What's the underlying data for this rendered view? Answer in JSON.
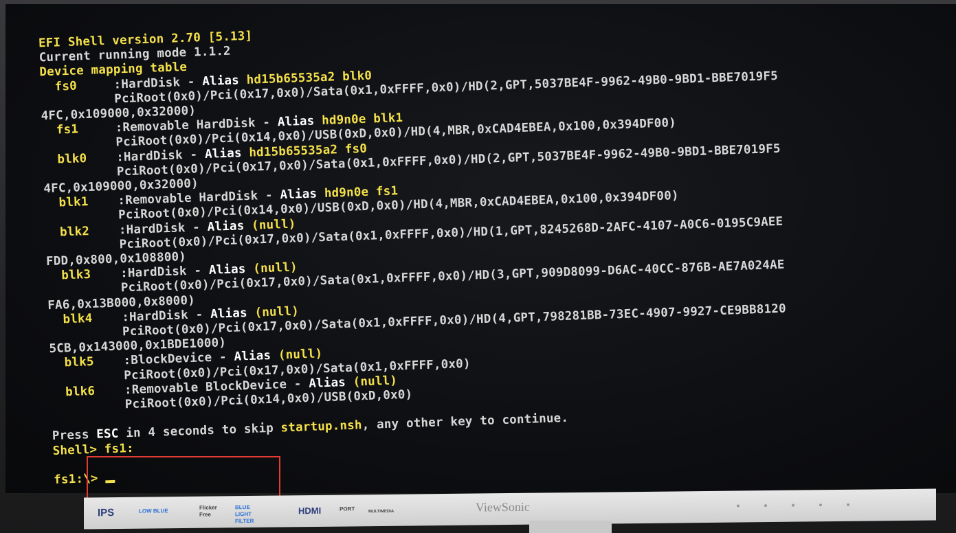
{
  "terminal": {
    "lines": [
      {
        "parts": [
          {
            "t": "EFI Shell version 2.70 [5.13]",
            "c": "y"
          }
        ]
      },
      {
        "parts": [
          {
            "t": "Current running mode 1.1.2",
            "c": ""
          }
        ]
      },
      {
        "parts": [
          {
            "t": "Device mapping table",
            "c": "y"
          }
        ]
      },
      {
        "parts": [
          {
            "t": "  fs0",
            "c": "y"
          },
          {
            "t": "     :HardDisk - ",
            "c": ""
          },
          {
            "t": "Alias ",
            "c": "w"
          },
          {
            "t": "hd15b65535a2 blk0",
            "c": "y"
          }
        ]
      },
      {
        "parts": [
          {
            "t": "          PciRoot(0x0)/Pci(0x17,0x0)/Sata(0x1,0xFFFF,0x0)/HD(2,GPT,5037BE4F-9962-49B0-9BD1-BBE7019F5",
            "c": ""
          }
        ]
      },
      {
        "parts": [
          {
            "t": "4FC,0x109000,0x32000)",
            "c": ""
          }
        ]
      },
      {
        "parts": [
          {
            "t": "  fs1",
            "c": "y"
          },
          {
            "t": "     :Removable HardDisk - ",
            "c": ""
          },
          {
            "t": "Alias ",
            "c": "w"
          },
          {
            "t": "hd9n0e blk1",
            "c": "y"
          }
        ]
      },
      {
        "parts": [
          {
            "t": "          PciRoot(0x0)/Pci(0x14,0x0)/USB(0xD,0x0)/HD(4,MBR,0xCAD4EBEA,0x100,0x394DF00)",
            "c": ""
          }
        ]
      },
      {
        "parts": [
          {
            "t": "  blk0",
            "c": "y"
          },
          {
            "t": "    :HardDisk - ",
            "c": ""
          },
          {
            "t": "Alias ",
            "c": "w"
          },
          {
            "t": "hd15b65535a2 fs0",
            "c": "y"
          }
        ]
      },
      {
        "parts": [
          {
            "t": "          PciRoot(0x0)/Pci(0x17,0x0)/Sata(0x1,0xFFFF,0x0)/HD(2,GPT,5037BE4F-9962-49B0-9BD1-BBE7019F5",
            "c": ""
          }
        ]
      },
      {
        "parts": [
          {
            "t": "4FC,0x109000,0x32000)",
            "c": ""
          }
        ]
      },
      {
        "parts": [
          {
            "t": "  blk1",
            "c": "y"
          },
          {
            "t": "    :Removable HardDisk - ",
            "c": ""
          },
          {
            "t": "Alias ",
            "c": "w"
          },
          {
            "t": "hd9n0e fs1",
            "c": "y"
          }
        ]
      },
      {
        "parts": [
          {
            "t": "          PciRoot(0x0)/Pci(0x14,0x0)/USB(0xD,0x0)/HD(4,MBR,0xCAD4EBEA,0x100,0x394DF00)",
            "c": ""
          }
        ]
      },
      {
        "parts": [
          {
            "t": "  blk2",
            "c": "y"
          },
          {
            "t": "    :HardDisk - ",
            "c": ""
          },
          {
            "t": "Alias ",
            "c": "w"
          },
          {
            "t": "(null)",
            "c": "y"
          }
        ]
      },
      {
        "parts": [
          {
            "t": "          PciRoot(0x0)/Pci(0x17,0x0)/Sata(0x1,0xFFFF,0x0)/HD(1,GPT,8245268D-2AFC-4107-A0C6-0195C9AEE",
            "c": ""
          }
        ]
      },
      {
        "parts": [
          {
            "t": "FDD,0x800,0x108800)",
            "c": ""
          }
        ]
      },
      {
        "parts": [
          {
            "t": "  blk3",
            "c": "y"
          },
          {
            "t": "    :HardDisk - ",
            "c": ""
          },
          {
            "t": "Alias ",
            "c": "w"
          },
          {
            "t": "(null)",
            "c": "y"
          }
        ]
      },
      {
        "parts": [
          {
            "t": "          PciRoot(0x0)/Pci(0x17,0x0)/Sata(0x1,0xFFFF,0x0)/HD(3,GPT,909D8099-D6AC-40CC-876B-AE7A024AE",
            "c": ""
          }
        ]
      },
      {
        "parts": [
          {
            "t": "FA6,0x13B000,0x8000)",
            "c": ""
          }
        ]
      },
      {
        "parts": [
          {
            "t": "  blk4",
            "c": "y"
          },
          {
            "t": "    :HardDisk - ",
            "c": ""
          },
          {
            "t": "Alias ",
            "c": "w"
          },
          {
            "t": "(null)",
            "c": "y"
          }
        ]
      },
      {
        "parts": [
          {
            "t": "          PciRoot(0x0)/Pci(0x17,0x0)/Sata(0x1,0xFFFF,0x0)/HD(4,GPT,798281BB-73EC-4907-9927-CE9BB8120",
            "c": ""
          }
        ]
      },
      {
        "parts": [
          {
            "t": "5CB,0x143000,0x1BDE1000)",
            "c": ""
          }
        ]
      },
      {
        "parts": [
          {
            "t": "  blk5",
            "c": "y"
          },
          {
            "t": "    :BlockDevice - ",
            "c": ""
          },
          {
            "t": "Alias ",
            "c": "w"
          },
          {
            "t": "(null)",
            "c": "y"
          }
        ]
      },
      {
        "parts": [
          {
            "t": "          PciRoot(0x0)/Pci(0x17,0x0)/Sata(0x1,0xFFFF,0x0)",
            "c": ""
          }
        ]
      },
      {
        "parts": [
          {
            "t": "  blk6",
            "c": "y"
          },
          {
            "t": "    :Removable BlockDevice - ",
            "c": ""
          },
          {
            "t": "Alias ",
            "c": "w"
          },
          {
            "t": "(null)",
            "c": "y"
          }
        ]
      },
      {
        "parts": [
          {
            "t": "          PciRoot(0x0)/Pci(0x14,0x0)/USB(0xD,0x0)",
            "c": ""
          }
        ]
      },
      {
        "parts": []
      },
      {
        "parts": [
          {
            "t": "Press ",
            "c": ""
          },
          {
            "t": "ESC",
            "c": "w"
          },
          {
            "t": " in 4 seconds to skip ",
            "c": ""
          },
          {
            "t": "startup.nsh",
            "c": "y"
          },
          {
            "t": ", any other key to continue.",
            "c": ""
          }
        ]
      },
      {
        "parts": [
          {
            "t": "Shell> fs1:",
            "c": "y"
          }
        ]
      },
      {
        "parts": []
      },
      {
        "parts": [
          {
            "t": "fs1:\\> ",
            "c": "y"
          }
        ]
      }
    ]
  },
  "bezel": {
    "badges": [
      "IPS",
      "LOW BLUE",
      "Flicker Free",
      "BLUE LIGHT FILTER",
      "HDMI",
      "PORT",
      "MULTIMEDIA"
    ],
    "brand": "ViewSonic"
  },
  "colors": {
    "yellow": "#f4e04a",
    "gray": "#d7d7d7",
    "white": "#ffffff",
    "highlight": "#e23b32"
  }
}
